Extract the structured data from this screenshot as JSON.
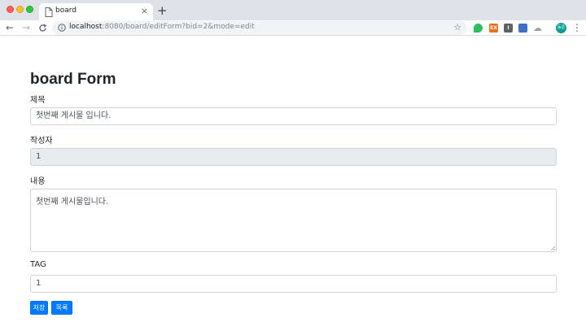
{
  "browser": {
    "tab_title": "board",
    "tab_close": "×",
    "new_tab": "+",
    "url_host": "localhost",
    "url_path": ":8080/board/editForm?bid=2&mode=edit",
    "nav_back": "←",
    "nav_forward": "→",
    "nav_reload": "C",
    "star": "☆",
    "menu": "⋮",
    "profile_initials": "동준",
    "ext_2_label": "EX",
    "ext_3_label": "I",
    "ext_5": "☁"
  },
  "form": {
    "title": "board Form",
    "subject_label": "제목",
    "subject_value": "첫번째 게시물 입니다.",
    "writer_label": "작성자",
    "writer_value": "1",
    "content_label": "내용",
    "content_value": "첫번째 게시물입니다.",
    "tag_label": "TAG",
    "tag_value": "1",
    "save_label": "저장",
    "list_label": "목록"
  },
  "colors": {
    "primary": "#007bff",
    "readonly_bg": "#e9ecef",
    "border": "#ced4da"
  }
}
